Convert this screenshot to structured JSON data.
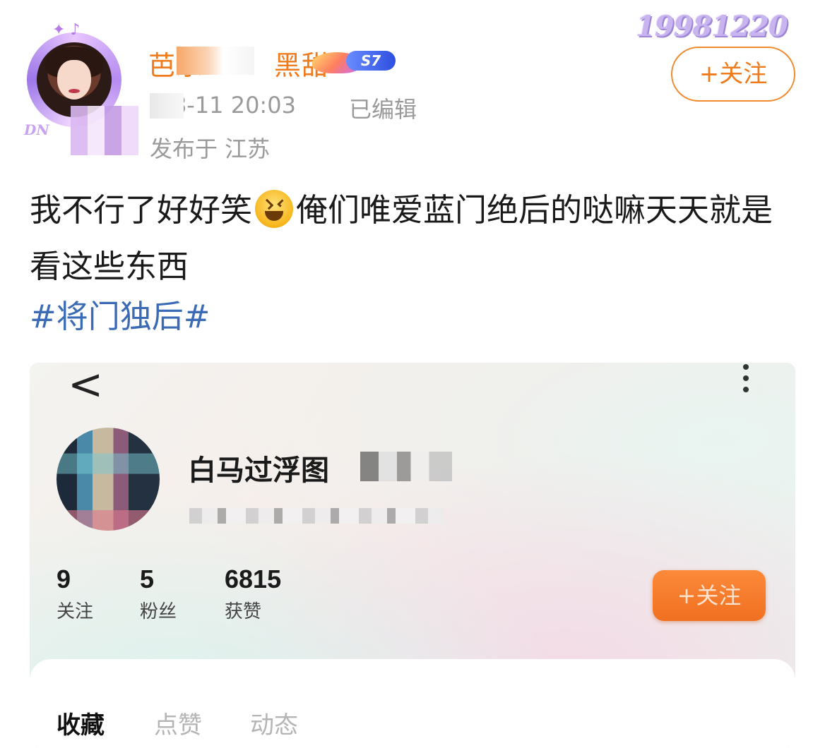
{
  "header": {
    "username": "芭乐",
    "username_suffix": "黑甜",
    "level": "S7",
    "timestamp": "5-8-11 20:03",
    "edited": "已编辑",
    "location": "发布于 江苏",
    "watermark": "19981220",
    "follow_label": "+关注",
    "avatar_tag": "DN",
    "avatar_stars": "✦ ♪"
  },
  "post": {
    "text_part1": "我不行了好好笑",
    "text_part2": "俺们唯爱蓝门绝后的哒嘛天天就是看这些东西",
    "hashtag": "#将门独后#"
  },
  "embedded": {
    "back_icon": "<",
    "profile_name": "白马过浮图",
    "stats": [
      {
        "value": "9",
        "label": "关注"
      },
      {
        "value": "5",
        "label": "粉丝"
      },
      {
        "value": "6815",
        "label": "获赞"
      }
    ],
    "follow_label": "+关注",
    "tabs": [
      {
        "label": "收藏",
        "active": true
      },
      {
        "label": "点赞",
        "active": false
      },
      {
        "label": "动态",
        "active": false
      }
    ]
  },
  "colors": {
    "accent": "#f07b1c",
    "hashtag": "#3b6bb4",
    "muted": "#9a9a9a"
  },
  "icons": [
    "back-chevron-icon",
    "more-vertical-icon",
    "laughing-emoji-icon",
    "level-badge-icon"
  ]
}
